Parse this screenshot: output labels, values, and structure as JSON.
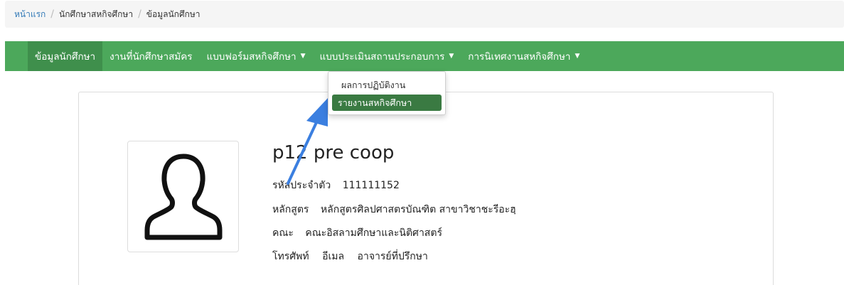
{
  "breadcrumb": {
    "home": "หน้าแรก",
    "section": "นักศึกษาสหกิจศึกษา",
    "current": "ข้อมูลนักศึกษา"
  },
  "navbar": {
    "items": [
      {
        "label": "ข้อมูลนักศึกษา",
        "active": true
      },
      {
        "label": "งานที่นักศึกษาสมัคร"
      },
      {
        "label": "แบบฟอร์มสหกิจศึกษา",
        "dropdown": true
      },
      {
        "label": "แบบประเมินสถานประกอบการ",
        "dropdown": true
      },
      {
        "label": "การนิเทศงานสหกิจศึกษา",
        "dropdown": true
      }
    ],
    "caret": "▼"
  },
  "dropdown": {
    "items": [
      "ผลการปฏิบัติงาน",
      "รายงานสหกิจศึกษา"
    ],
    "highlighted_index": 1
  },
  "profile": {
    "name": "p12 pre coop",
    "student_id_label": "รหัสประจำตัว",
    "student_id": "111111152",
    "program_label": "หลักสูตร",
    "program": "หลักสูตรศิลปศาสตรบัณฑิต สาขาวิชาชะรีอะฮฺ",
    "faculty_label": "คณะ",
    "faculty": "คณะอิสลามศึกษาและนิติศาสตร์",
    "phone_label": "โทรศัพท์",
    "email_label": "อีเมล",
    "advisor_label": "อาจารย์ที่ปรึกษา"
  },
  "colors": {
    "navbar": "#4ca85b",
    "active": "#3f8f4c",
    "highlight": "#3a7a42",
    "arrow": "#3b7fe0"
  },
  "icons": {
    "avatar": "user-silhouette-icon",
    "caret": "caret-down-icon",
    "annotation": "pointer-arrow"
  }
}
